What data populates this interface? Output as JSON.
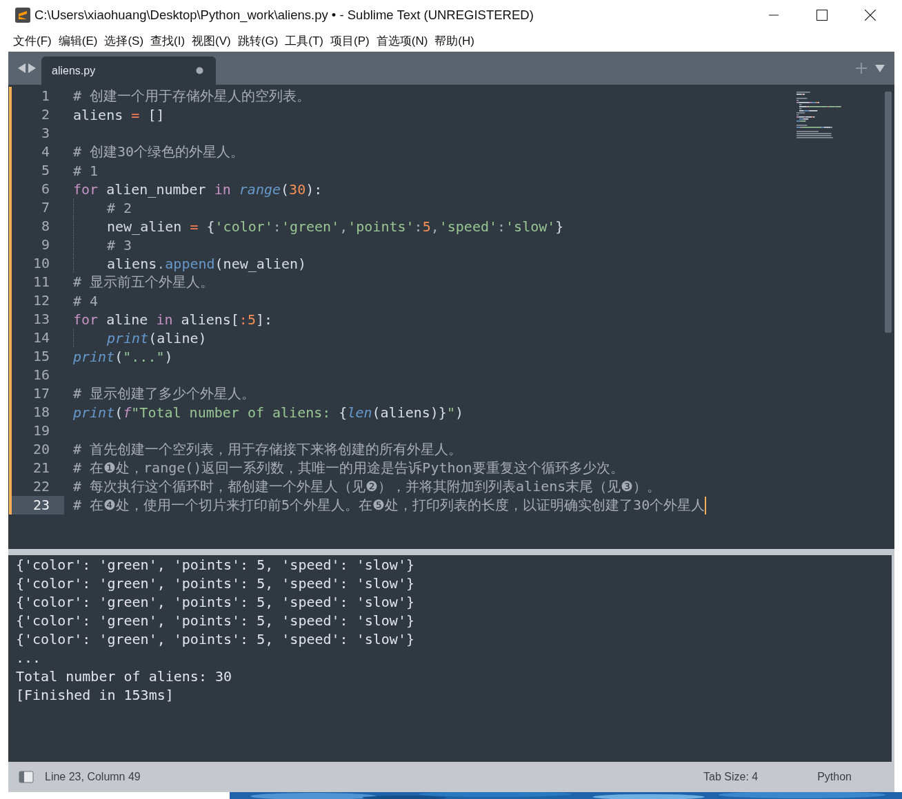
{
  "window": {
    "title": "C:\\Users\\xiaohuang\\Desktop\\Python_work\\aliens.py • - Sublime Text (UNREGISTERED)"
  },
  "menu": [
    "文件(F)",
    "编辑(E)",
    "选择(S)",
    "查找(I)",
    "视图(V)",
    "跳转(G)",
    "工具(T)",
    "项目(P)",
    "首选项(N)",
    "帮助(H)"
  ],
  "tabs": [
    {
      "label": "aliens.py",
      "selected": true,
      "modified": true
    }
  ],
  "editor": {
    "lines": [
      {
        "number": "1",
        "current": false,
        "tokens": [
          {
            "kind": "comment",
            "text": "# 创建一个用于存储外星人的空列表。"
          }
        ]
      },
      {
        "number": "2",
        "current": false,
        "tokens": [
          {
            "kind": "plain",
            "text": "aliens "
          },
          {
            "kind": "operator",
            "text": "="
          },
          {
            "kind": "plain",
            "text": " []"
          }
        ]
      },
      {
        "number": "3",
        "current": false
      },
      {
        "number": "4",
        "current": false,
        "tokens": [
          {
            "kind": "comment",
            "text": "# 创建30个绿色的外星人。"
          }
        ]
      },
      {
        "number": "5",
        "current": false,
        "tokens": [
          {
            "kind": "comment",
            "text": "# 1"
          }
        ]
      },
      {
        "number": "6",
        "current": false,
        "tokens": [
          {
            "kind": "keyword",
            "text": "for"
          },
          {
            "kind": "plain",
            "text": " alien_number "
          },
          {
            "kind": "keyword",
            "text": "in "
          },
          {
            "kind": "builtin",
            "text": "range"
          },
          {
            "kind": "plain",
            "text": "("
          },
          {
            "kind": "number",
            "text": "30"
          },
          {
            "kind": "plain",
            "text": "):"
          }
        ],
        "children": [
          {
            "number": "7",
            "current": false,
            "tokens": [
              {
                "kind": "comment",
                "text": "# 2"
              }
            ]
          },
          {
            "number": "8",
            "current": false,
            "tokens": [
              {
                "kind": "plain",
                "text": "new_alien "
              },
              {
                "kind": "operator",
                "text": "="
              },
              {
                "kind": "plain",
                "text": " {"
              },
              {
                "kind": "string",
                "text": "'color'"
              },
              {
                "kind": "punct",
                "text": ":"
              },
              {
                "kind": "string",
                "text": "'green'"
              },
              {
                "kind": "punct",
                "text": ","
              },
              {
                "kind": "string",
                "text": "'points'"
              },
              {
                "kind": "punct",
                "text": ":"
              },
              {
                "kind": "number",
                "text": "5"
              },
              {
                "kind": "punct",
                "text": ","
              },
              {
                "kind": "string",
                "text": "'speed'"
              },
              {
                "kind": "punct",
                "text": ":"
              },
              {
                "kind": "string",
                "text": "'slow'"
              },
              {
                "kind": "plain",
                "text": "}"
              }
            ]
          },
          {
            "number": "9",
            "current": false,
            "tokens": [
              {
                "kind": "comment",
                "text": "# 3"
              }
            ]
          },
          {
            "number": "10",
            "current": false,
            "tokens": [
              {
                "kind": "plain",
                "text": "aliens"
              },
              {
                "kind": "punct",
                "text": "."
              },
              {
                "kind": "method",
                "text": "append"
              },
              {
                "kind": "plain",
                "text": "(new_alien)"
              }
            ]
          }
        ]
      },
      {
        "number": "11",
        "current": false,
        "tokens": [
          {
            "kind": "comment",
            "text": "# 显示前五个外星人。"
          }
        ]
      },
      {
        "number": "12",
        "current": false,
        "tokens": [
          {
            "kind": "comment",
            "text": "# 4"
          }
        ]
      },
      {
        "number": "13",
        "current": false,
        "tokens": [
          {
            "kind": "keyword",
            "text": "for"
          },
          {
            "kind": "plain",
            "text": " aline "
          },
          {
            "kind": "keyword",
            "text": "in"
          },
          {
            "kind": "plain",
            "text": " aliens["
          },
          {
            "kind": "operator",
            "text": ":"
          },
          {
            "kind": "number",
            "text": "5"
          },
          {
            "kind": "plain",
            "text": "]:"
          }
        ],
        "children": [
          {
            "number": "14",
            "current": false,
            "tokens": [
              {
                "kind": "builtin",
                "text": "print"
              },
              {
                "kind": "plain",
                "text": "(aline)"
              }
            ]
          }
        ]
      },
      {
        "number": "15",
        "current": false,
        "tokens": [
          {
            "kind": "builtin",
            "text": "print"
          },
          {
            "kind": "plain",
            "text": "("
          },
          {
            "kind": "string",
            "text": "\"...\""
          },
          {
            "kind": "plain",
            "text": ")"
          }
        ]
      },
      {
        "number": "16",
        "current": false
      },
      {
        "number": "17",
        "current": false,
        "tokens": [
          {
            "kind": "comment",
            "text": "# 显示创建了多少个外星人。"
          }
        ]
      },
      {
        "number": "18",
        "current": false,
        "tokens": [
          {
            "kind": "builtin",
            "text": "print"
          },
          {
            "kind": "plain",
            "text": "("
          },
          {
            "kind": "fprefix",
            "text": "f"
          },
          {
            "kind": "string",
            "text": "\"Total number of aliens: "
          },
          {
            "kind": "plain",
            "text": "{"
          },
          {
            "kind": "builtin",
            "text": "len"
          },
          {
            "kind": "plain",
            "text": "(aliens)}"
          },
          {
            "kind": "string",
            "text": "\""
          },
          {
            "kind": "plain",
            "text": ")"
          }
        ]
      },
      {
        "number": "19",
        "current": false
      },
      {
        "number": "20",
        "current": false,
        "tokens": [
          {
            "kind": "comment",
            "text": "# 首先创建一个空列表，用于存储接下来将创建的所有外星人。"
          }
        ]
      },
      {
        "number": "21",
        "current": false,
        "tokens": [
          {
            "kind": "comment",
            "text": "# 在❶处，range()返回一系列数，其唯一的用途是告诉Python要重复这个循环多少次。"
          }
        ]
      },
      {
        "number": "22",
        "current": false,
        "tokens": [
          {
            "kind": "comment",
            "text": "# 每次执行这个循环时，都创建一个外星人（见❷），并将其附加到列表aliens末尾（见❸）。"
          }
        ]
      },
      {
        "number": "23",
        "current": true,
        "tokens": [
          {
            "kind": "comment",
            "text": "# 在❹处，使用一个切片来打印前5个外星人。在❺处，打印列表的长度，以证明确实创建了30个外星人"
          }
        ]
      }
    ]
  },
  "output": [
    "{'color': 'green', 'points': 5, 'speed': 'slow'}",
    "{'color': 'green', 'points': 5, 'speed': 'slow'}",
    "{'color': 'green', 'points': 5, 'speed': 'slow'}",
    "{'color': 'green', 'points': 5, 'speed': 'slow'}",
    "{'color': 'green', 'points': 5, 'speed': 'slow'}",
    "...",
    "Total number of aliens: 30",
    "[Finished in 153ms]"
  ],
  "status_bar": {
    "position": "Line 23, Column 49",
    "tab_size": "Tab Size: 4",
    "syntax": "Python"
  }
}
